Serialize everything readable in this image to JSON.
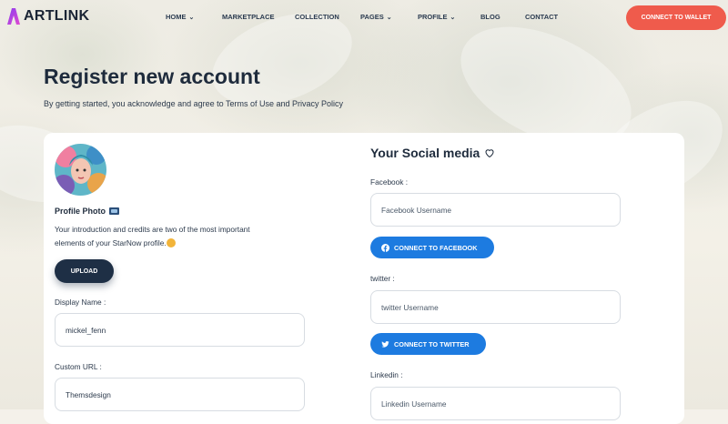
{
  "brand": {
    "name": "ARTLINK",
    "accent": "#ef5b4c",
    "primary_dark": "#1e2f45",
    "social_blue": "#1d7be0"
  },
  "nav": {
    "items": [
      {
        "label": "HOME",
        "has_dropdown": true
      },
      {
        "label": "MARKETPLACE",
        "has_dropdown": false
      },
      {
        "label": "COLLECTION",
        "has_dropdown": false
      },
      {
        "label": "PAGES",
        "has_dropdown": true
      },
      {
        "label": "PROFILE",
        "has_dropdown": true
      },
      {
        "label": "BLOG",
        "has_dropdown": false
      },
      {
        "label": "CONTACT",
        "has_dropdown": false
      }
    ],
    "wallet_button": "CONNECT TO WALLET"
  },
  "page": {
    "title": "Register new account",
    "subtitle": "By getting started, you acknowledge and agree to Terms of Use and Privacy Policy"
  },
  "profile": {
    "photo_label": "Profile Photo",
    "intro_line1": "Your introduction and credits are two of the most important",
    "intro_line2": "elements of your StarNow profile.",
    "upload_button": "UPLOAD",
    "display_name_label": "Display Name :",
    "display_name_value": "mickel_fenn",
    "custom_url_label": "Custom URL :",
    "custom_url_value": "Themsdesign"
  },
  "social": {
    "title": "Your Social media",
    "facebook_label": "Facebook :",
    "facebook_placeholder": "Facebook Username",
    "facebook_button": "CONNECT TO FACEBOOK",
    "twitter_label": "twitter :",
    "twitter_placeholder": "twitter Username",
    "twitter_button": "CONNECT TO TWITTER",
    "linkedin_label": "Linkedin :",
    "linkedin_placeholder": "Linkedin Username"
  },
  "icons": [
    "chevron-down-icon",
    "photo-icon",
    "emoji-icon",
    "heart-icon",
    "facebook-icon",
    "twitter-icon"
  ]
}
